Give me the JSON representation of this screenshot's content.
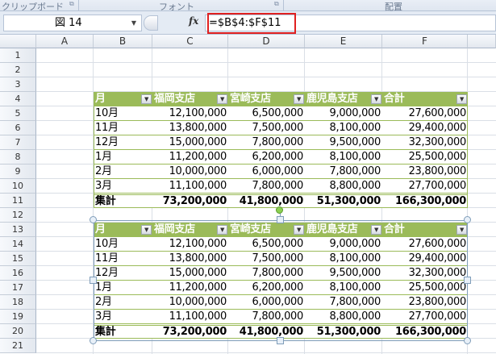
{
  "ribbon": {
    "groups": [
      "クリップボード",
      "フォント",
      "配置"
    ]
  },
  "formula_bar": {
    "name_box": "図 14",
    "fx": "fx",
    "formula": "=$B$4:$F$11"
  },
  "columns": [
    "A",
    "B",
    "C",
    "D",
    "E",
    "F"
  ],
  "rows": [
    "1",
    "2",
    "3",
    "4",
    "5",
    "6",
    "7",
    "8",
    "9",
    "10",
    "11",
    "12",
    "13",
    "14",
    "15",
    "16",
    "17",
    "18",
    "19",
    "20",
    "21"
  ],
  "table": {
    "headers": [
      "月",
      "福岡支店",
      "宮崎支店",
      "鹿児島支店",
      "合計"
    ],
    "rows": [
      [
        "10月",
        "12,100,000",
        "6,500,000",
        "9,000,000",
        "27,600,000"
      ],
      [
        "11月",
        "13,800,000",
        "7,500,000",
        "8,100,000",
        "29,400,000"
      ],
      [
        "12月",
        "15,000,000",
        "7,800,000",
        "9,500,000",
        "32,300,000"
      ],
      [
        "1月",
        "11,200,000",
        "6,200,000",
        "8,100,000",
        "25,500,000"
      ],
      [
        "2月",
        "10,000,000",
        "6,000,000",
        "7,800,000",
        "23,800,000"
      ],
      [
        "3月",
        "11,100,000",
        "7,800,000",
        "8,800,000",
        "27,700,000"
      ]
    ],
    "total": [
      "集計",
      "73,200,000",
      "41,800,000",
      "51,300,000",
      "166,300,000"
    ]
  },
  "picture": {
    "headers": [
      "月",
      "福岡支店",
      "宮崎支店",
      "鹿児島支店",
      "合計"
    ],
    "rows": [
      [
        "10月",
        "12,100,000",
        "6,500,000",
        "9,000,000",
        "27,600,000"
      ],
      [
        "11月",
        "13,800,000",
        "7,500,000",
        "8,100,000",
        "29,400,000"
      ],
      [
        "12月",
        "15,000,000",
        "7,800,000",
        "9,500,000",
        "32,300,000"
      ],
      [
        "1月",
        "11,200,000",
        "6,200,000",
        "8,100,000",
        "25,500,000"
      ],
      [
        "2月",
        "10,000,000",
        "6,000,000",
        "7,800,000",
        "23,800,000"
      ],
      [
        "3月",
        "11,100,000",
        "7,800,000",
        "8,800,000",
        "27,700,000"
      ]
    ],
    "total": [
      "集計",
      "73,200,000",
      "41,800,000",
      "51,300,000",
      "166,300,000"
    ]
  },
  "colors": {
    "header": "#9bbb59",
    "highlight": "#e02020"
  }
}
